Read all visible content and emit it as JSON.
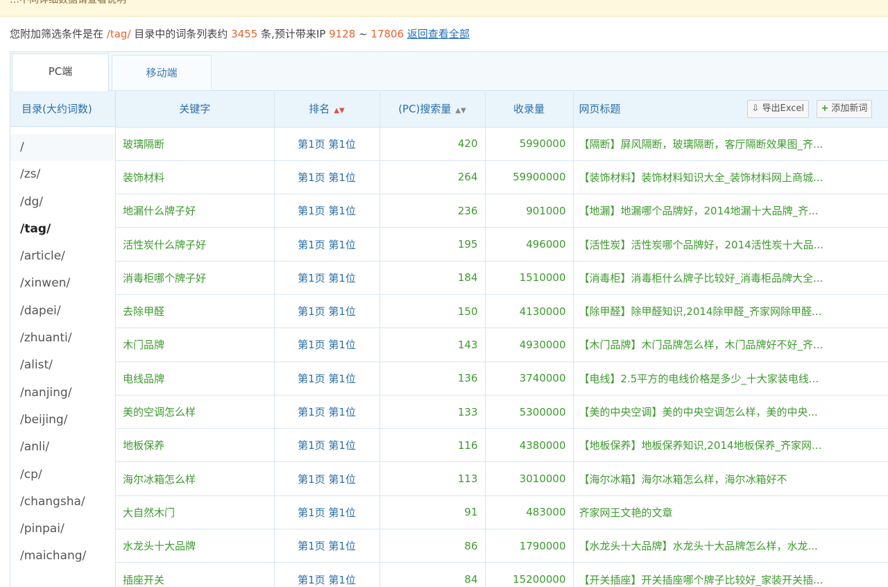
{
  "banner": {
    "text": "…不同详细数据请查看说明"
  },
  "summary": {
    "prefix": "您附加筛选条件是在",
    "directory": "/tag/",
    "middle": "目录中的词条列表约",
    "count": "3455",
    "count_unit": "条,预计带来IP",
    "ip_min": "9128",
    "ip_sep": "~",
    "ip_max": "17806",
    "back_link": "返回查看全部"
  },
  "tabs": [
    {
      "label": "PC端"
    },
    {
      "label": "移动端"
    }
  ],
  "sidebar": {
    "header": "目录(大约词数)",
    "items": [
      "/",
      "/zs/",
      "/dg/",
      "/tag/",
      "/article/",
      "/xinwen/",
      "/dapei/",
      "/zhuanti/",
      "/alist/",
      "/nanjing/",
      "/beijing/",
      "/anli/",
      "/cp/",
      "/changsha/",
      "/pinpai/",
      "/maichang/"
    ],
    "active_index": 3
  },
  "table": {
    "headers": {
      "keyword": "关键字",
      "rank": "排名",
      "search": "(PC)搜索量",
      "indexed": "收录量",
      "title": "网页标题"
    },
    "sort_icons": {
      "rank": "▲▼",
      "search": "▲▼"
    },
    "buttons": {
      "export": "导出Excel",
      "add": "添加新词",
      "export_icon": "export-icon",
      "add_icon": "plus-icon"
    },
    "rows": [
      {
        "keyword": "玻璃隔断",
        "rank": "第1页 第1位",
        "search": "420",
        "indexed": "5990000",
        "title": "【隔断】屏风隔断，玻璃隔断，客厅隔断效果图_齐..."
      },
      {
        "keyword": "装饰材料",
        "rank": "第1页 第1位",
        "search": "264",
        "indexed": "59900000",
        "title": "【装饰材料】装饰材料知识大全_装饰材料网上商城..."
      },
      {
        "keyword": "地漏什么牌子好",
        "rank": "第1页 第1位",
        "search": "236",
        "indexed": "901000",
        "title": "【地漏】地漏哪个品牌好，2014地漏十大品牌_齐..."
      },
      {
        "keyword": "活性炭什么牌子好",
        "rank": "第1页 第1位",
        "search": "195",
        "indexed": "496000",
        "title": "【活性炭】活性炭哪个品牌好，2014活性炭十大品..."
      },
      {
        "keyword": "消毒柜哪个牌子好",
        "rank": "第1页 第1位",
        "search": "184",
        "indexed": "1510000",
        "title": "【消毒柜】消毒柜什么牌子比较好_消毒柜品牌大全..."
      },
      {
        "keyword": "去除甲醛",
        "rank": "第1页 第1位",
        "search": "150",
        "indexed": "4130000",
        "title": "【除甲醛】除甲醛知识,2014除甲醛_齐家网除甲醛..."
      },
      {
        "keyword": "木门品牌",
        "rank": "第1页 第1位",
        "search": "143",
        "indexed": "4930000",
        "title": "【木门品牌】木门品牌怎么样，木门品牌好不好_齐..."
      },
      {
        "keyword": "电线品牌",
        "rank": "第1页 第1位",
        "search": "136",
        "indexed": "3740000",
        "title": "【电线】2.5平方的电线价格是多少_十大家装电线..."
      },
      {
        "keyword": "美的空调怎么样",
        "rank": "第1页 第1位",
        "search": "133",
        "indexed": "5300000",
        "title": "【美的中央空调】美的中央空调怎么样，美的中央..."
      },
      {
        "keyword": "地板保养",
        "rank": "第1页 第1位",
        "search": "116",
        "indexed": "4380000",
        "title": "【地板保养】地板保养知识,2014地板保养_齐家网..."
      },
      {
        "keyword": "海尔冰箱怎么样",
        "rank": "第1页 第1位",
        "search": "113",
        "indexed": "3010000",
        "title": "【海尔冰箱】海尔冰箱怎么样，海尔冰箱好不"
      },
      {
        "keyword": "大自然木门",
        "rank": "第1页 第1位",
        "search": "91",
        "indexed": "483000",
        "title": "齐家网王文艳的文章"
      },
      {
        "keyword": "水龙头十大品牌",
        "rank": "第1页 第1位",
        "search": "86",
        "indexed": "1790000",
        "title": "【水龙头十大品牌】水龙头十大品牌怎么样，水龙..."
      },
      {
        "keyword": "插座开关",
        "rank": "第1页 第1位",
        "search": "84",
        "indexed": "15200000",
        "title": "【开关插座】开关插座哪个牌子比较好_家装开关插..."
      }
    ]
  }
}
